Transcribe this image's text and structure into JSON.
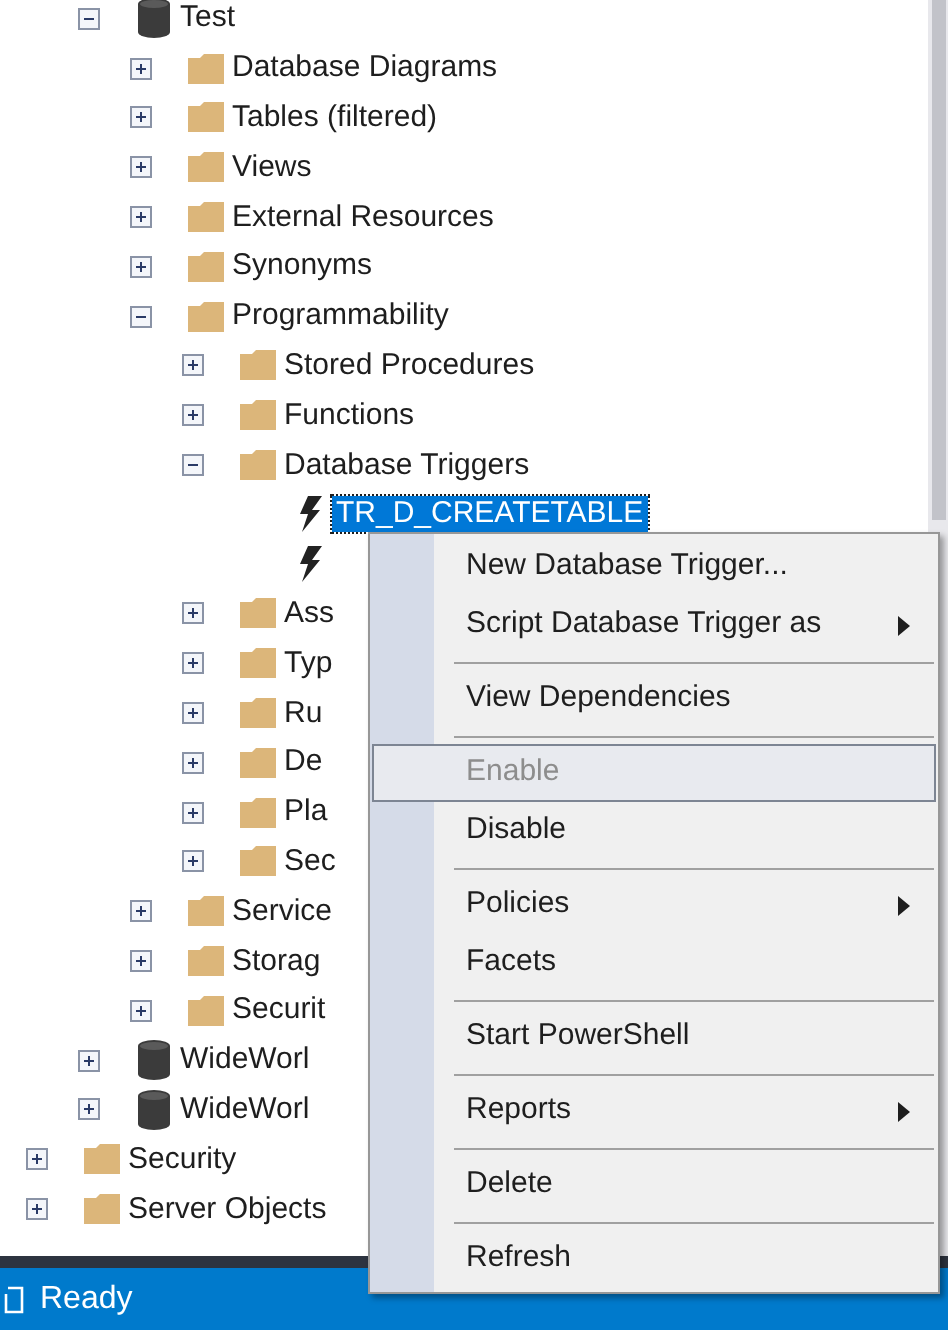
{
  "tree": {
    "items": [
      {
        "children": [
          {
            "label": "Test",
            "kind": "database",
            "expanded": true,
            "children": [
              {
                "label": "Database Diagrams",
                "kind": "folder",
                "expanded": false
              },
              {
                "label": "Tables (filtered)",
                "kind": "folder",
                "expanded": false
              },
              {
                "label": "Views",
                "kind": "folder",
                "expanded": false
              },
              {
                "label": "External Resources",
                "kind": "folder",
                "expanded": false
              },
              {
                "label": "Synonyms",
                "kind": "folder",
                "expanded": false
              },
              {
                "label": "Programmability",
                "kind": "folder",
                "expanded": true,
                "children": [
                  {
                    "label": "Stored Procedures",
                    "kind": "folder",
                    "expanded": false
                  },
                  {
                    "label": "Functions",
                    "kind": "folder",
                    "expanded": false
                  },
                  {
                    "label": "Database Triggers",
                    "kind": "folder",
                    "expanded": true,
                    "children": [
                      {
                        "label": "TR_D_CREATETABLE",
                        "kind": "trigger",
                        "selected": true
                      },
                      {
                        "kind": "trigger"
                      }
                    ]
                  },
                  {
                    "label": "Ass",
                    "kind": "folder",
                    "expanded": false
                  },
                  {
                    "label": "Typ",
                    "kind": "folder",
                    "expanded": false
                  },
                  {
                    "label": "Ru",
                    "kind": "folder",
                    "expanded": false
                  },
                  {
                    "label": "De",
                    "kind": "folder",
                    "expanded": false
                  },
                  {
                    "label": "Pla",
                    "kind": "folder",
                    "expanded": false
                  },
                  {
                    "label": "Sec",
                    "kind": "folder",
                    "expanded": false
                  }
                ]
              },
              {
                "label": "Service",
                "kind": "folder",
                "expanded": false
              },
              {
                "label": "Storag",
                "kind": "folder",
                "expanded": false
              },
              {
                "label": "Securit",
                "kind": "folder",
                "expanded": false
              }
            ]
          },
          {
            "label": "WideWorl",
            "kind": "database",
            "expanded": false
          },
          {
            "label": "WideWorl",
            "kind": "database",
            "expanded": false
          }
        ]
      },
      {
        "label": "Security",
        "kind": "folder",
        "expanded": false
      },
      {
        "label": "Server Objects",
        "kind": "folder",
        "expanded": false
      }
    ]
  },
  "context_menu": {
    "items": [
      {
        "kind": "item",
        "label": "New Database Trigger...",
        "submenu": false,
        "disabled": false,
        "highlighted": false
      },
      {
        "kind": "item",
        "label": "Script Database Trigger as",
        "submenu": true,
        "disabled": false,
        "highlighted": false
      },
      {
        "kind": "separator"
      },
      {
        "kind": "item",
        "label": "View Dependencies",
        "submenu": false,
        "disabled": false,
        "highlighted": false
      },
      {
        "kind": "separator"
      },
      {
        "kind": "item",
        "label": "Enable",
        "submenu": false,
        "disabled": true,
        "highlighted": true
      },
      {
        "kind": "item",
        "label": "Disable",
        "submenu": false,
        "disabled": false,
        "highlighted": false
      },
      {
        "kind": "separator"
      },
      {
        "kind": "item",
        "label": "Policies",
        "submenu": true,
        "disabled": false,
        "highlighted": false
      },
      {
        "kind": "item",
        "label": "Facets",
        "submenu": false,
        "disabled": false,
        "highlighted": false
      },
      {
        "kind": "separator"
      },
      {
        "kind": "item",
        "label": "Start PowerShell",
        "submenu": false,
        "disabled": false,
        "highlighted": false
      },
      {
        "kind": "separator"
      },
      {
        "kind": "item",
        "label": "Reports",
        "submenu": true,
        "disabled": false,
        "highlighted": false
      },
      {
        "kind": "separator"
      },
      {
        "kind": "item",
        "label": "Delete",
        "submenu": false,
        "disabled": false,
        "highlighted": false
      },
      {
        "kind": "separator"
      },
      {
        "kind": "item",
        "label": "Refresh",
        "submenu": false,
        "disabled": false,
        "highlighted": false
      }
    ]
  },
  "status_bar": {
    "text": "Ready"
  }
}
